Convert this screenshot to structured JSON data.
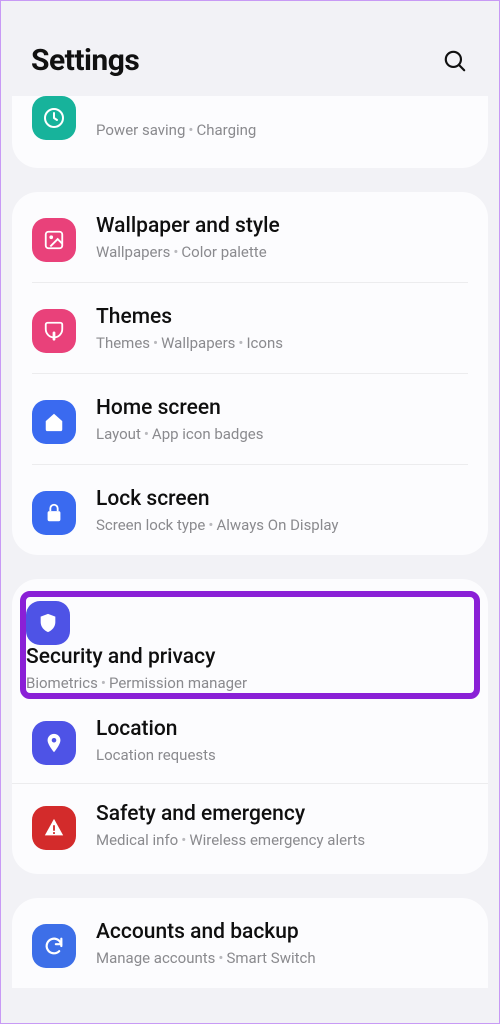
{
  "header": {
    "title": "Settings"
  },
  "groups": [
    {
      "partial": "top",
      "items": [
        {
          "id": "battery",
          "title": "",
          "sub": [
            "Power saving",
            "Charging"
          ],
          "icon": "battery",
          "color": "bg-teal"
        }
      ]
    },
    {
      "items": [
        {
          "id": "wallpaper",
          "title": "Wallpaper and style",
          "sub": [
            "Wallpapers",
            "Color palette"
          ],
          "icon": "image",
          "color": "bg-pink"
        },
        {
          "id": "themes",
          "title": "Themes",
          "sub": [
            "Themes",
            "Wallpapers",
            "Icons"
          ],
          "icon": "brush",
          "color": "bg-pink2"
        },
        {
          "id": "home",
          "title": "Home screen",
          "sub": [
            "Layout",
            "App icon badges"
          ],
          "icon": "home",
          "color": "bg-blue"
        },
        {
          "id": "lock",
          "title": "Lock screen",
          "sub": [
            "Screen lock type",
            "Always On Display"
          ],
          "icon": "lock",
          "color": "bg-blue2"
        }
      ]
    },
    {
      "highlightIndex": 0,
      "items": [
        {
          "id": "security",
          "title": "Security and privacy",
          "sub": [
            "Biometrics",
            "Permission manager"
          ],
          "icon": "shield",
          "color": "bg-indigo"
        },
        {
          "id": "location",
          "title": "Location",
          "sub": [
            "Location requests"
          ],
          "icon": "pin",
          "color": "bg-indigo2"
        },
        {
          "id": "safety",
          "title": "Safety and emergency",
          "sub": [
            "Medical info",
            "Wireless emergency alerts"
          ],
          "icon": "alert",
          "color": "bg-red"
        }
      ]
    },
    {
      "partial": "bottom",
      "items": [
        {
          "id": "accounts",
          "title": "Accounts and backup",
          "sub": [
            "Manage accounts",
            "Smart Switch"
          ],
          "icon": "sync",
          "color": "bg-bblue"
        }
      ]
    }
  ]
}
